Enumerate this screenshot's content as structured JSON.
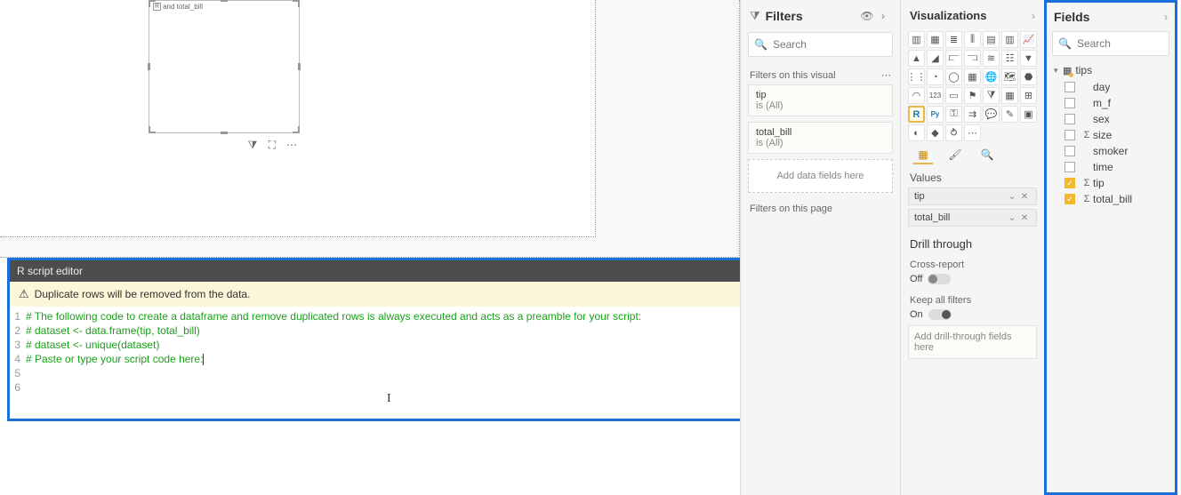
{
  "canvas": {
    "visual_title": "and total_bill"
  },
  "r_editor": {
    "title": "R script editor",
    "warning": "Duplicate rows will be removed from the data.",
    "lines": [
      "# The following code to create a dataframe and remove duplicated rows is always executed and acts as a preamble for your script:",
      "",
      "# dataset <- data.frame(tip, total_bill)",
      "# dataset <- unique(dataset)",
      "",
      "# Paste or type your script code here:"
    ]
  },
  "filters": {
    "title": "Filters",
    "search_placeholder": "Search",
    "section_visual": "Filters on this visual",
    "cards": [
      {
        "field": "tip",
        "state": "is (All)"
      },
      {
        "field": "total_bill",
        "state": "is (All)"
      }
    ],
    "add_fields": "Add data fields here",
    "section_page": "Filters on this page"
  },
  "viz": {
    "title": "Visualizations",
    "values_label": "Values",
    "pills": [
      "tip",
      "total_bill"
    ],
    "drill_title": "Drill through",
    "cross": "Cross-report",
    "cross_state": "Off",
    "keep": "Keep all filters",
    "keep_state": "On",
    "drill_drop": "Add drill-through fields here"
  },
  "fields": {
    "title": "Fields",
    "search_placeholder": "Search",
    "table": "tips",
    "rows": [
      {
        "name": "day",
        "checked": false,
        "sigma": false
      },
      {
        "name": "m_f",
        "checked": false,
        "sigma": false
      },
      {
        "name": "sex",
        "checked": false,
        "sigma": false
      },
      {
        "name": "size",
        "checked": false,
        "sigma": true
      },
      {
        "name": "smoker",
        "checked": false,
        "sigma": false
      },
      {
        "name": "time",
        "checked": false,
        "sigma": false
      },
      {
        "name": "tip",
        "checked": true,
        "sigma": true
      },
      {
        "name": "total_bill",
        "checked": true,
        "sigma": true
      }
    ]
  }
}
